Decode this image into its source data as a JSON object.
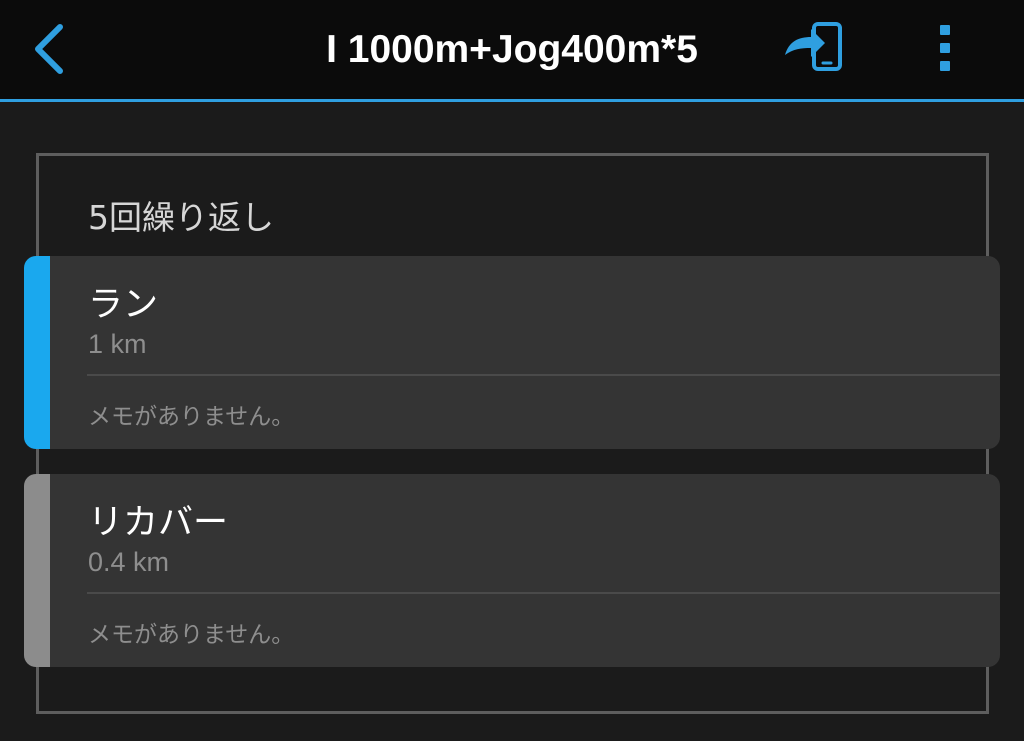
{
  "header": {
    "title": "I 1000m+Jog400m*5",
    "back_icon": "chevron-left-icon",
    "send_icon": "send-to-device-icon",
    "menu_icon": "more-vertical-icon",
    "accent_color": "#2f9fe0"
  },
  "repeat": {
    "label": "5回繰り返し"
  },
  "steps": [
    {
      "name": "ラン",
      "distance": "1 km",
      "note": "メモがありません。",
      "color": "#1aa8ee"
    },
    {
      "name": "リカバー",
      "distance": "0.4 km",
      "note": "メモがありません。",
      "color": "#8c8c8c"
    }
  ]
}
